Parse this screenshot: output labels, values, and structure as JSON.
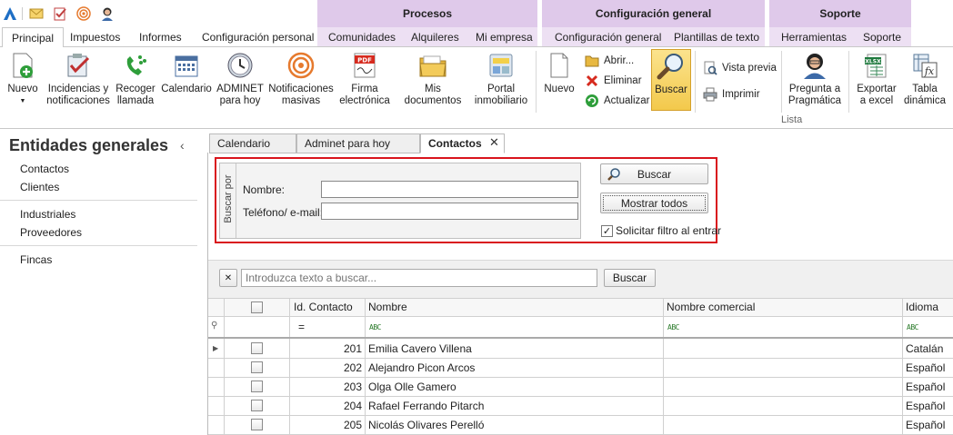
{
  "ribbon": {
    "categories": [
      {
        "label": "Procesos"
      },
      {
        "label": "Configuración general"
      },
      {
        "label": "Soporte"
      }
    ],
    "tabs": [
      {
        "label": "Principal"
      },
      {
        "label": "Impuestos"
      },
      {
        "label": "Informes"
      },
      {
        "label": "Configuración personal"
      },
      {
        "label": "Comunidades"
      },
      {
        "label": "Alquileres"
      },
      {
        "label": "Mi empresa"
      },
      {
        "label": "Configuración general"
      },
      {
        "label": "Plantillas de texto"
      },
      {
        "label": "Herramientas"
      },
      {
        "label": "Soporte"
      }
    ],
    "buttons": {
      "nuevo": "Nuevo",
      "incidencias_1": "Incidencias y",
      "incidencias_2": "notificaciones",
      "recoger_1": "Recoger",
      "recoger_2": "llamada",
      "calendario": "Calendario",
      "adminet_1": "ADMINET",
      "adminet_2": "para hoy",
      "notif_1": "Notificaciones",
      "notif_2": "masivas",
      "firma_1": "Firma",
      "firma_2": "electrónica",
      "misdocs": "Mis documentos",
      "portal_1": "Portal",
      "portal_2": "inmobiliario",
      "nuevo2": "Nuevo",
      "abrir": "Abrir...",
      "eliminar": "Eliminar",
      "actualizar": "Actualizar",
      "buscar": "Buscar",
      "vista_previa": "Vista previa",
      "imprimir": "Imprimir",
      "pregunta_1": "Pregunta a",
      "pregunta_2": "Pragmática",
      "exportar_1": "Exportar",
      "exportar_2": "a excel",
      "tabla_1": "Tabla",
      "tabla_2": "dinámica",
      "group_lista": "Lista"
    }
  },
  "sidebar": {
    "title": "Entidades generales",
    "items": [
      {
        "label": "Contactos"
      },
      {
        "label": "Clientes"
      },
      {
        "label": "Industriales"
      },
      {
        "label": "Proveedores"
      },
      {
        "label": "Fincas"
      }
    ]
  },
  "doc_tabs": [
    {
      "label": "Calendario"
    },
    {
      "label": "Adminet para hoy"
    },
    {
      "label": "Contactos"
    }
  ],
  "search_panel": {
    "group_label": "Buscar por",
    "nombre_label": "Nombre:",
    "nombre_value": "",
    "telefono_label": "Teléfono/ e-mail:",
    "telefono_value": "",
    "buscar_button": "Buscar",
    "mostrar_todos_button": "Mostrar todos",
    "solicitar_filtro_label": "Solicitar filtro al entrar",
    "solicitar_filtro_checked": true
  },
  "find_bar": {
    "placeholder": "Introduzca texto a buscar...",
    "button": "Buscar"
  },
  "grid": {
    "columns": [
      "Id. Contacto",
      "Nombre",
      "Nombre comercial",
      "Idioma"
    ],
    "filter_eq": "=",
    "filter_abc": "ABC",
    "rows": [
      {
        "id": "201",
        "nombre": "Emilia Cavero Villena",
        "comercial": "",
        "idioma": "Catalán"
      },
      {
        "id": "202",
        "nombre": "Alejandro Picon Arcos",
        "comercial": "",
        "idioma": "Español"
      },
      {
        "id": "203",
        "nombre": "Olga Olle Gamero",
        "comercial": "",
        "idioma": "Español"
      },
      {
        "id": "204",
        "nombre": "Rafael Ferrando Pitarch",
        "comercial": "",
        "idioma": "Español"
      },
      {
        "id": "205",
        "nombre": "Nicolás Olivares Perelló",
        "comercial": "",
        "idioma": "Español"
      }
    ]
  },
  "colors": {
    "category_bg": "#dfc9ea",
    "highlight_border": "#d9141c",
    "active_button": "#f7d56a"
  }
}
